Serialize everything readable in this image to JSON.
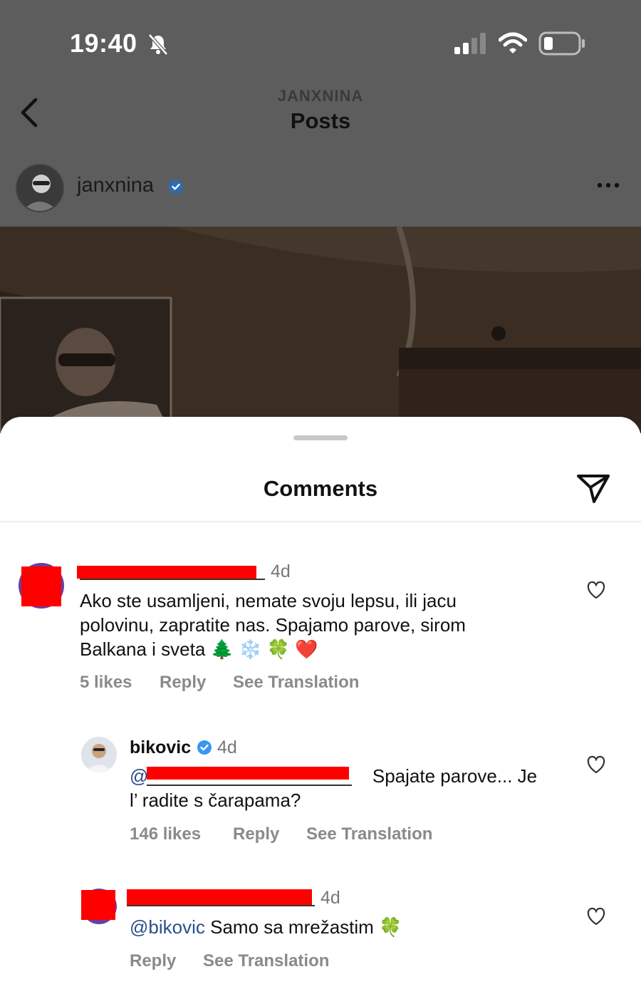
{
  "status_bar": {
    "time": "19:40"
  },
  "header": {
    "subtitle": "JANXNINA",
    "title": "Posts"
  },
  "post": {
    "username": "janxnina"
  },
  "sheet": {
    "title": "Comments"
  },
  "comments": [
    {
      "time": "4d",
      "text_lines": [
        "Ako ste usamljeni, nemate svoju lepsu, ili jacu",
        "polovinu, zapratite nas. Spajamo parove, sirom",
        "Balkana i sveta"
      ],
      "emoji": [
        "🌲",
        "❄️",
        "🍀",
        "❤️"
      ],
      "likes": "5 likes",
      "reply_label": "Reply",
      "translate_label": "See Translation"
    },
    {
      "username": "bikovic",
      "time": "4d",
      "mention_prefix": "@",
      "text_line1": "Spajate parove... Je",
      "text_line2": "l’ radite s čarapama?",
      "likes": "146 likes",
      "reply_label": "Reply",
      "translate_label": "See Translation"
    },
    {
      "time": "4d",
      "mention": "@bikovic",
      "text": "Samo sa mrežastim",
      "emoji": "🍀",
      "reply_label": "Reply",
      "translate_label": "See Translation"
    }
  ],
  "colors": {
    "redaction": "#ff0000",
    "verified": "#3897f0",
    "mention": "#2a4e8a"
  },
  "icons": [
    "bell-slash-icon",
    "signal-icon",
    "wifi-icon",
    "battery-icon",
    "back-chevron-icon",
    "verified-badge-icon",
    "more-options-icon",
    "share-icon",
    "heart-icon"
  ]
}
